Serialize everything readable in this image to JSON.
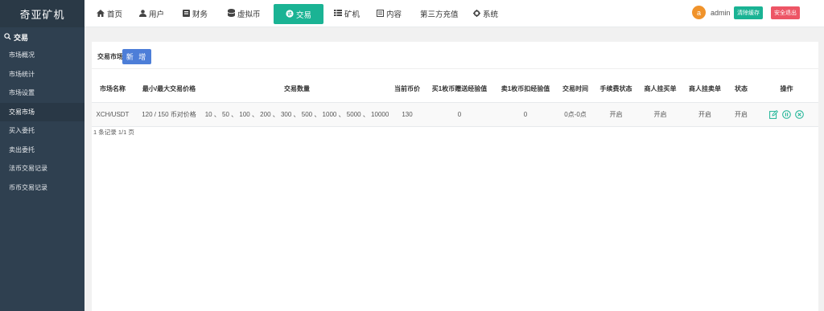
{
  "app": {
    "brand": "奇亚矿机"
  },
  "sidebar": {
    "section": {
      "icon": "search-icon",
      "label": "交易"
    },
    "items": [
      {
        "label": "市场概况"
      },
      {
        "label": "市场统计"
      },
      {
        "label": "市场设置"
      },
      {
        "label": "交易市场",
        "active": true
      },
      {
        "label": "买入委托"
      },
      {
        "label": "卖出委托"
      },
      {
        "label": "法币交易记录"
      },
      {
        "label": "币币交易记录"
      }
    ]
  },
  "topnav": {
    "items": [
      {
        "icon": "home-icon",
        "label": "首页"
      },
      {
        "icon": "user-icon",
        "label": "用户"
      },
      {
        "icon": "finance-icon",
        "label": "财务"
      },
      {
        "icon": "database-icon",
        "label": "虚拟币"
      },
      {
        "icon": "trade-icon",
        "label": "交易",
        "active": true
      },
      {
        "icon": "grid-icon",
        "label": "矿机"
      },
      {
        "icon": "content-icon",
        "label": "内容"
      },
      {
        "icon": "",
        "label": "第三方充值"
      },
      {
        "icon": "gear-icon",
        "label": "系统"
      }
    ],
    "avatar_letter": "a",
    "username": "admin",
    "clear_cache": "清除缓存",
    "logout": "安全退出",
    "colors": {
      "accent": "#1ab394",
      "danger": "#ed5565",
      "avatar": "#f0932b",
      "primary": "#4d7ed8"
    }
  },
  "toolbar": {
    "label": "交易市场",
    "add_button": "新 增"
  },
  "table": {
    "headers": [
      "市场名称",
      "最小/最大交易价格",
      "交易数量",
      "当前币价",
      "买1枚币赠送经验值",
      "卖1枚币扣经验值",
      "交易时间",
      "手续费状态",
      "商人挂买单",
      "商人挂卖单",
      "状态",
      "操作"
    ],
    "rows": [
      {
        "market": "XCH/USDT",
        "price_range": "120 / 150 币对价格",
        "quantities": "10 、 50 、 100 、 200 、 300 、 500 、 1000 、 5000 、 10000",
        "current_price": "130",
        "buy_exp": "0",
        "sell_exp": "0",
        "trade_time": "0点-0点",
        "fee_status": "开启",
        "merchant_buy": "开启",
        "merchant_sell": "开启",
        "status": "开启"
      }
    ],
    "footer": "1 条记录 1/1 页"
  }
}
